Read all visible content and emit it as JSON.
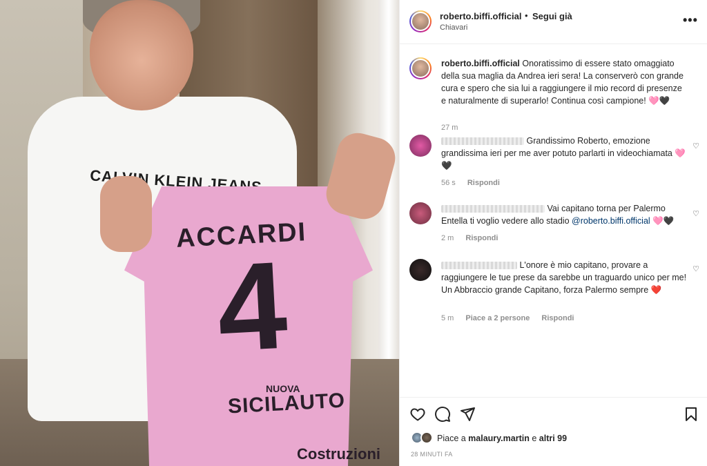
{
  "post": {
    "username": "roberto.biffi.official",
    "follow_status": "Segui già",
    "location": "Chiavari",
    "more_label": "•••"
  },
  "photo": {
    "shirt_text": "CALVIN KLEIN JEANS",
    "jersey_name": "ACCARDI",
    "jersey_number": "4",
    "sponsor_small": "NUOVA",
    "sponsor_main": "SICILAUTO",
    "sponsor_bottom": "Costruzioni"
  },
  "caption": {
    "username": "roberto.biffi.official",
    "text": "Onoratissimo di essere stato omaggiato della sua maglia da Andrea ieri sera! La conserverò con grande cura e spero che sia lui a raggiungere il mio record di presenze e naturalmente di superarlo! Continua così campione! 🩷🖤",
    "time": "27 m"
  },
  "comments": [
    {
      "text": "Grandissimo Roberto, emozione grandissima ieri per me aver potuto parlarti in videochiamata 🩷🖤",
      "time": "56 s",
      "reply": "Rispondi",
      "likes": ""
    },
    {
      "text": "Vai capitano torna per Palermo Entella ti voglio vedere allo stadio",
      "mention": "@roberto.biffi.official",
      "suffix": " 🩷🖤",
      "time": "2 m",
      "reply": "Rispondi",
      "likes": ""
    },
    {
      "text": "L'onore è mio capitano, provare a raggiungere le tue prese da sarebbe un traguardo unico per me!",
      "text2": "Un Abbraccio grande Capitano, forza Palermo sempre ❤️",
      "time": "5 m",
      "likes": "Piace a 2 persone",
      "reply": "Rispondi"
    }
  ],
  "footer": {
    "likes_prefix": "Piace a ",
    "likes_user": "malaury.martin",
    "likes_mid": " e ",
    "likes_others": "altri 99",
    "timestamp": "28 MINUTI FA"
  },
  "icons": [
    "heart-icon",
    "comment-icon",
    "share-icon",
    "bookmark-icon",
    "more-icon"
  ],
  "colors": {
    "link": "#00376b",
    "muted": "#8e8e8e",
    "text": "#262626",
    "jersey": "#e9a8cf"
  }
}
